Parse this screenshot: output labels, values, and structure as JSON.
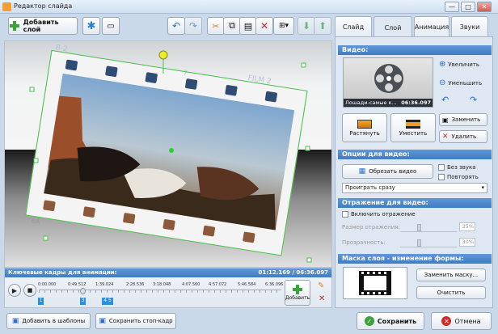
{
  "window": {
    "title": "Редактор слайда",
    "min": "—",
    "max": "□",
    "close": "✕"
  },
  "toolbar": {
    "add_layer": "Добавить слой"
  },
  "canvas": {
    "film_text_top": "FILM 2",
    "film_text_left": "B-2",
    "film_num": "7",
    "film_bottom_left": "6A"
  },
  "tabs": [
    {
      "label": "Слайд"
    },
    {
      "label": "Слой"
    },
    {
      "label": "Анимация"
    },
    {
      "label": "Звуки"
    }
  ],
  "video": {
    "header": "Видео:",
    "zoom_in": "Увеличить",
    "zoom_out": "Уменьшить",
    "file_name": "Лошади-самые к...",
    "duration": "06:36.097",
    "stretch": "Растянуть",
    "fit": "Уместить",
    "replace": "Заменить",
    "delete": "Удалить"
  },
  "video_options": {
    "header": "Опции для видео:",
    "crop": "Обрезать видео",
    "no_sound": "Без звука",
    "repeat": "Повторять",
    "play_mode": "Проиграть сразу"
  },
  "reflection": {
    "header": "Отражение для видео:",
    "enable": "Включить отражение",
    "size_label": "Размер отражения:",
    "size_value": "35%",
    "opacity_label": "Прозрачность:",
    "opacity_value": "30%"
  },
  "mask": {
    "header": "Маска слоя - изменение формы:",
    "replace": "Заменить маску...",
    "clear": "Очистить"
  },
  "timeline": {
    "header": "Ключевые кадры для анимации:",
    "time": "01:12.169 / 06:36.097",
    "ticks": [
      "0:00.000",
      "0:49.512",
      "1:39.024",
      "2:28.536",
      "3:18.048",
      "4:07.560",
      "4:57.072",
      "5:46.584",
      "6:36.096"
    ],
    "keyframes": [
      "1",
      "3",
      "4 5"
    ],
    "add": "Добавить"
  },
  "bottom": {
    "add_templates": "Добавить в шаблоны",
    "save_keyframe": "Сохранить стоп-кадр",
    "save": "Сохранить",
    "cancel": "Отмена"
  }
}
